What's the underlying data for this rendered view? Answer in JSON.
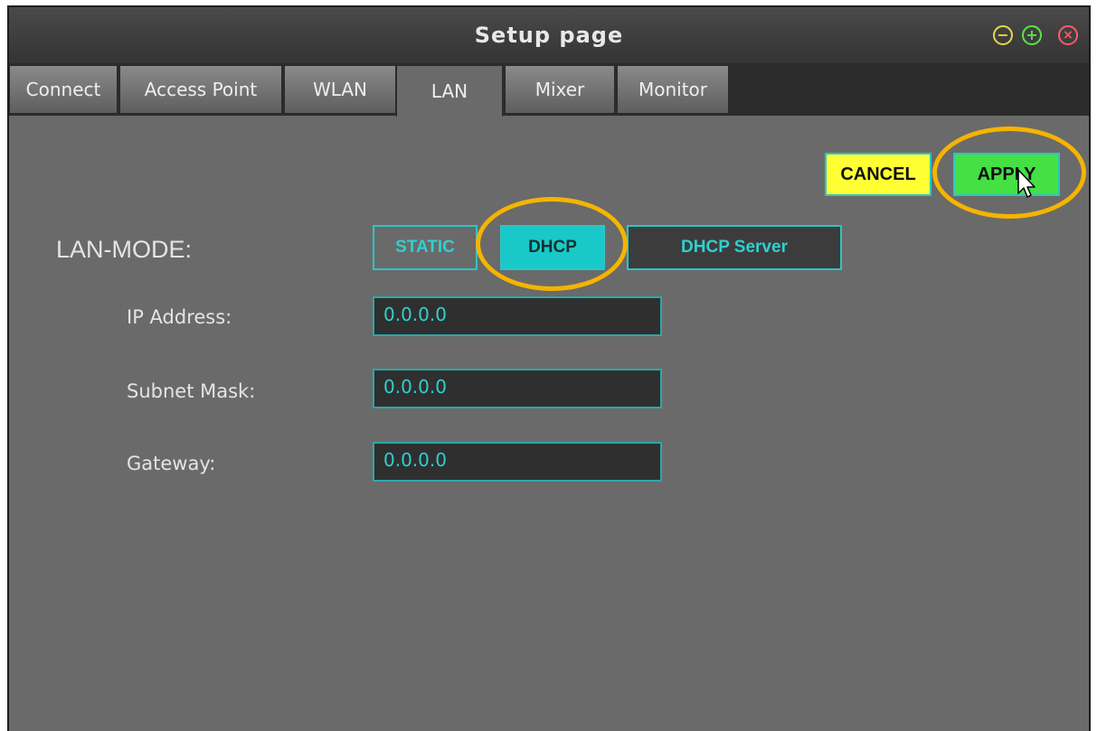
{
  "window": {
    "title": "Setup page",
    "controls": {
      "minimize": "minus-circle-icon",
      "maximize": "plus-circle-icon",
      "close": "x-circle-icon"
    },
    "control_colors": {
      "minimize": "#e6d84a",
      "maximize": "#5ee04a",
      "close": "#ff5a6a"
    }
  },
  "tabs": [
    {
      "label": "Connect"
    },
    {
      "label": "Access Point"
    },
    {
      "label": "WLAN"
    },
    {
      "label": "LAN",
      "active": true
    },
    {
      "label": "Mixer"
    },
    {
      "label": "Monitor"
    }
  ],
  "actions": {
    "cancel_label": "CANCEL",
    "apply_label": "APPLY"
  },
  "lan": {
    "mode_label": "LAN-MODE:",
    "modes": [
      {
        "label": "STATIC",
        "selected": false
      },
      {
        "label": "DHCP",
        "selected": true
      },
      {
        "label": "DHCP Server",
        "selected": false
      }
    ],
    "fields": [
      {
        "label": "IP Address:",
        "value": "0.0.0.0"
      },
      {
        "label": "Subnet Mask:",
        "value": "0.0.0.0"
      },
      {
        "label": "Gateway:",
        "value": "0.0.0.0"
      }
    ]
  },
  "colors": {
    "accent": "#2dc5c5",
    "cancel": "#ffff33",
    "apply": "#44e044",
    "highlight": "#f5b400",
    "panel": "#6a6a6a"
  },
  "cursor": "pointer-cursor-icon"
}
